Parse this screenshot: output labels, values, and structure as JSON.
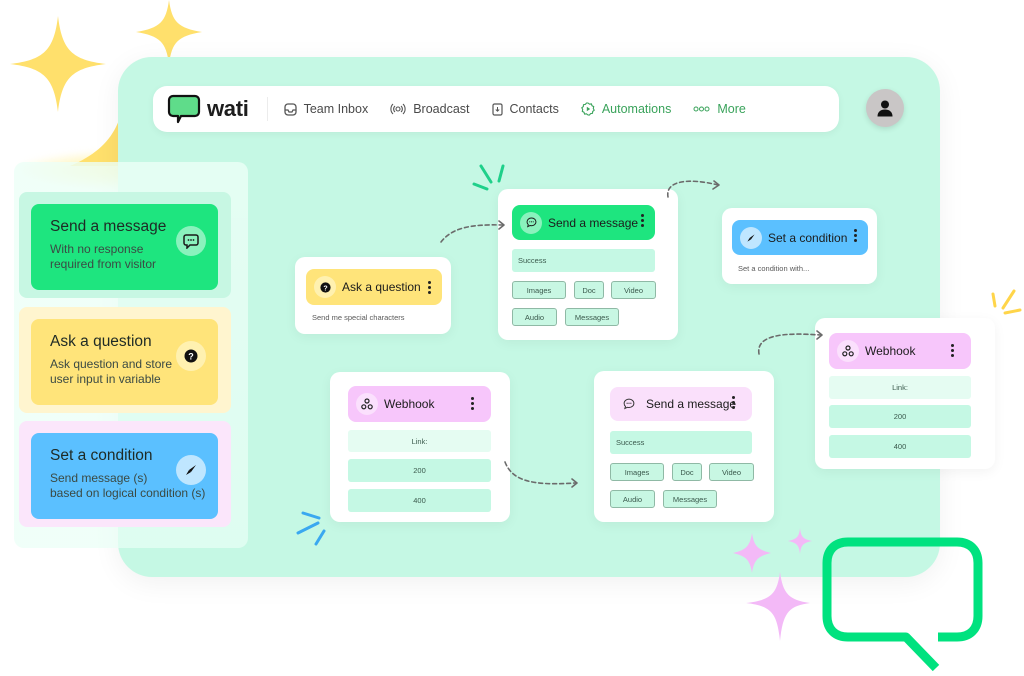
{
  "brand": {
    "name": "wati",
    "accent": "#00e27f",
    "active_nav_color": "#3aa35b"
  },
  "navbar": {
    "items": [
      {
        "label": "Team Inbox",
        "icon": "inbox-icon",
        "active": false
      },
      {
        "label": "Broadcast",
        "icon": "broadcast-icon",
        "active": false
      },
      {
        "label": "Contacts",
        "icon": "contacts-icon",
        "active": false
      },
      {
        "label": "Automations",
        "icon": "automation-icon",
        "active": true
      },
      {
        "label": "More",
        "icon": "more-dots-icon",
        "active": false
      }
    ],
    "avatar_icon": "user-icon"
  },
  "palette": {
    "items": [
      {
        "title": "Send a message",
        "subtitle_1": "With no response",
        "subtitle_2": "required from visitor",
        "icon": "chat-bubble-icon",
        "color": "#1ee57f"
      },
      {
        "title": "Ask a question",
        "subtitle_1": "Ask question and store",
        "subtitle_2": "user input in variable",
        "icon": "question-icon",
        "color": "#ffe47a"
      },
      {
        "title": "Set a condition",
        "subtitle_1": "Send message (s)",
        "subtitle_2": "based on logical condition (s)",
        "icon": "compass-icon",
        "color": "#5bc0ff"
      }
    ]
  },
  "flow": {
    "ask_question": {
      "title": "Ask a question",
      "description": "Send me special characters"
    },
    "send_message_1": {
      "title": "Send a message",
      "status": "Success",
      "chips": [
        "Images",
        "Doc",
        "Video",
        "Audio",
        "Messages"
      ]
    },
    "set_condition": {
      "title": "Set a condition",
      "description": "Set a condition with..."
    },
    "webhook_1": {
      "title": "Webhook",
      "link_label": "Link:",
      "responses": [
        "200",
        "400"
      ]
    },
    "send_message_2": {
      "title": "Send a message",
      "status": "Success",
      "chips": [
        "Images",
        "Doc",
        "Video",
        "Audio",
        "Messages"
      ]
    },
    "webhook_2": {
      "title": "Webhook",
      "link_label": "Link:",
      "responses": [
        "200",
        "400"
      ]
    }
  }
}
